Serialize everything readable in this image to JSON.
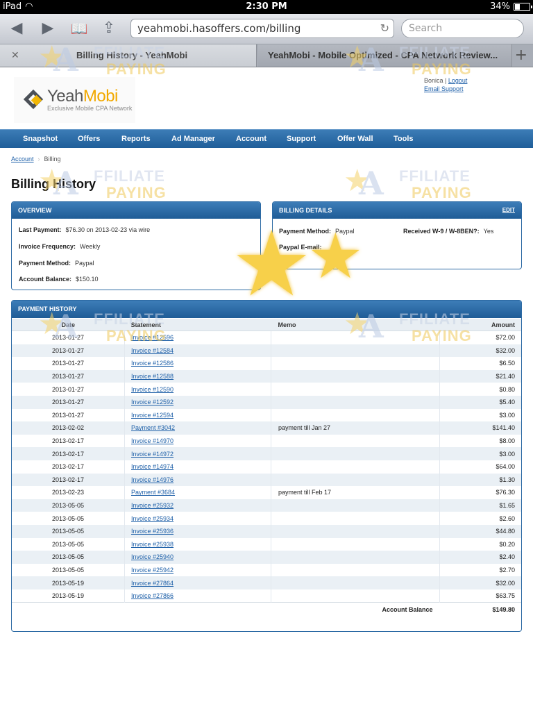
{
  "statusbar": {
    "device": "iPad",
    "time": "2:30 PM",
    "battery": "34%",
    "battery_level": 0.34
  },
  "toolbar": {
    "url": "yeahmobi.hasoffers.com/billing",
    "search_placeholder": "Search"
  },
  "tabs": [
    {
      "title": "Billing History - YeahMobi",
      "active": true
    },
    {
      "title": "YeahMobi - Mobile Optimized - CPA Network Review...",
      "active": false
    }
  ],
  "header": {
    "logo_name_1": "Yeah",
    "logo_name_2": "Mobi",
    "logo_tagline": "Exclusive Mobile CPA Network",
    "user": "Bonica",
    "sep": "|",
    "logout": "Logout",
    "support": "Email Support"
  },
  "nav": [
    "Snapshot",
    "Offers",
    "Reports",
    "Ad Manager",
    "Account",
    "Support",
    "Offer Wall",
    "Tools"
  ],
  "breadcrumb": {
    "parent": "Account",
    "current": "Billing"
  },
  "page_title": "Billing History",
  "overview": {
    "title": "OVERVIEW",
    "last_payment_label": "Last Payment:",
    "last_payment": "$76.30 on 2013-02-23 via wire",
    "invoice_freq_label": "Invoice Frequency:",
    "invoice_freq": "Weekly",
    "payment_method_label": "Payment Method:",
    "payment_method": "Paypal",
    "balance_label": "Account Balance:",
    "balance": "$150.10"
  },
  "billing_details": {
    "title": "BILLING DETAILS",
    "edit": "EDIT",
    "payment_method_label": "Payment Method:",
    "payment_method": "Paypal",
    "w9_label": "Received W-9 / W-8BEN?:",
    "w9": "Yes",
    "paypal_email_label": "Paypal E-mail:"
  },
  "payment_history": {
    "title": "PAYMENT HISTORY",
    "headers": {
      "date": "Date",
      "statement": "Statement",
      "memo": "Memo",
      "amount": "Amount"
    },
    "rows": [
      {
        "date": "2013-01-27",
        "statement": "Invoice #12596",
        "memo": "",
        "amount": "$72.00"
      },
      {
        "date": "2013-01-27",
        "statement": "Invoice #12584",
        "memo": "",
        "amount": "$32.00"
      },
      {
        "date": "2013-01-27",
        "statement": "Invoice #12586",
        "memo": "",
        "amount": "$6.50"
      },
      {
        "date": "2013-01-27",
        "statement": "Invoice #12588",
        "memo": "",
        "amount": "$21.40"
      },
      {
        "date": "2013-01-27",
        "statement": "Invoice #12590",
        "memo": "",
        "amount": "$0.80"
      },
      {
        "date": "2013-01-27",
        "statement": "Invoice #12592",
        "memo": "",
        "amount": "$5.40"
      },
      {
        "date": "2013-01-27",
        "statement": "Invoice #12594",
        "memo": "",
        "amount": "$3.00"
      },
      {
        "date": "2013-02-02",
        "statement": "Payment #3042",
        "memo": "payment till Jan 27",
        "amount": "$141.40"
      },
      {
        "date": "2013-02-17",
        "statement": "Invoice #14970",
        "memo": "",
        "amount": "$8.00"
      },
      {
        "date": "2013-02-17",
        "statement": "Invoice #14972",
        "memo": "",
        "amount": "$3.00"
      },
      {
        "date": "2013-02-17",
        "statement": "Invoice #14974",
        "memo": "",
        "amount": "$64.00"
      },
      {
        "date": "2013-02-17",
        "statement": "Invoice #14976",
        "memo": "",
        "amount": "$1.30"
      },
      {
        "date": "2013-02-23",
        "statement": "Payment #3684",
        "memo": "payment till Feb 17",
        "amount": "$76.30"
      },
      {
        "date": "2013-05-05",
        "statement": "Invoice #25932",
        "memo": "",
        "amount": "$1.65"
      },
      {
        "date": "2013-05-05",
        "statement": "Invoice #25934",
        "memo": "",
        "amount": "$2.60"
      },
      {
        "date": "2013-05-05",
        "statement": "Invoice #25936",
        "memo": "",
        "amount": "$44.80"
      },
      {
        "date": "2013-05-05",
        "statement": "Invoice #25938",
        "memo": "",
        "amount": "$0.20"
      },
      {
        "date": "2013-05-05",
        "statement": "Invoice #25940",
        "memo": "",
        "amount": "$2.40"
      },
      {
        "date": "2013-05-05",
        "statement": "Invoice #25942",
        "memo": "",
        "amount": "$2.70"
      },
      {
        "date": "2013-05-19",
        "statement": "Invoice #27864",
        "memo": "",
        "amount": "$32.00"
      },
      {
        "date": "2013-05-19",
        "statement": "Invoice #27866",
        "memo": "",
        "amount": "$63.75"
      }
    ],
    "total_label": "Account Balance",
    "total": "$149.80"
  },
  "watermark": {
    "letter": "A",
    "line1": "FFILIATE",
    "line2": "PAYING"
  },
  "colors": {
    "nav": "#1f5e99",
    "link": "#1d5fa8",
    "logo_accent": "#f2a900",
    "row_alt": "#eaf0f5"
  },
  "icons": [
    "wifi-icon",
    "battery-icon",
    "back-icon",
    "forward-icon",
    "bookmarks-icon",
    "share-icon",
    "reload-icon",
    "close-tab-icon",
    "new-tab-icon",
    "star-icon"
  ]
}
